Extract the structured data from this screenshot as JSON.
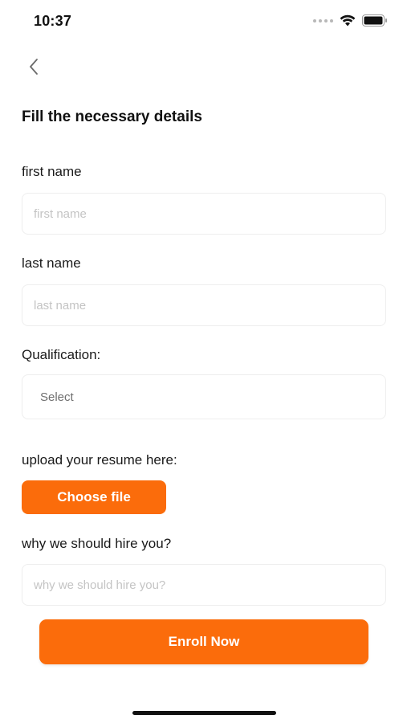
{
  "status_bar": {
    "time": "10:37"
  },
  "header": {
    "back_icon": "chevron-left-icon",
    "title": "Fill the necessary details"
  },
  "form": {
    "first_name": {
      "label": "first name",
      "placeholder": "first name",
      "value": ""
    },
    "last_name": {
      "label": "last name",
      "placeholder": "last name",
      "value": ""
    },
    "qualification": {
      "label": "Qualification:",
      "selected": "Select"
    },
    "resume": {
      "label": "upload your resume here:",
      "button_label": "Choose file"
    },
    "why_hire": {
      "label": "why we should hire you?",
      "placeholder": "why we should hire you?",
      "value": ""
    },
    "submit_label": "Enroll Now"
  },
  "colors": {
    "accent": "#fb6c0b",
    "placeholder": "#c4c4c4",
    "field_border": "#eeeeee"
  }
}
